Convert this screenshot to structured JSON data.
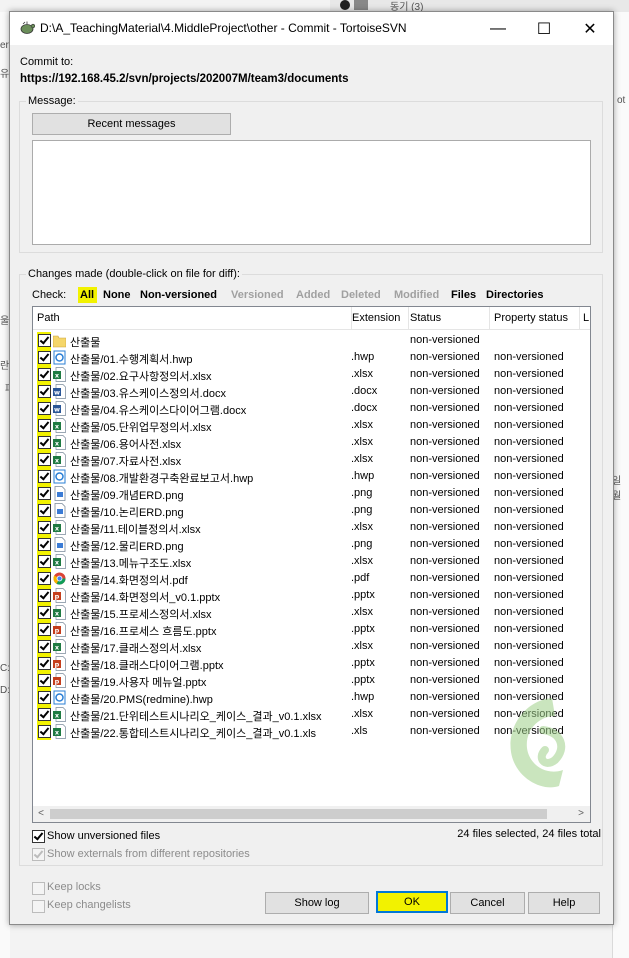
{
  "window": {
    "title": "D:\\A_TeachingMaterial\\4.MiddleProject\\other - Commit - TortoiseSVN",
    "minimize": "—",
    "maximize": "☐",
    "close": "✕"
  },
  "background": {
    "top_text": "동기 (3)",
    "left_frags": [
      "er",
      "유",
      "란",
      "파",
      "울",
      "C:",
      "D:"
    ],
    "right_frags": [
      "ot",
      "일월"
    ]
  },
  "commit": {
    "to_label": "Commit to:",
    "url": "https://192.168.45.2/svn/projects/202007M/team3/documents",
    "message_label": "Message:",
    "recent_messages": "Recent messages",
    "message_text": ""
  },
  "changes": {
    "label": "Changes made (double-click on file for diff):",
    "check_label": "Check:",
    "filters": [
      {
        "label": "All",
        "enabled": true
      },
      {
        "label": "None",
        "enabled": true
      },
      {
        "label": "Non-versioned",
        "enabled": true
      },
      {
        "label": "Versioned",
        "enabled": false
      },
      {
        "label": "Added",
        "enabled": false
      },
      {
        "label": "Deleted",
        "enabled": false
      },
      {
        "label": "Modified",
        "enabled": false
      },
      {
        "label": "Files",
        "enabled": true
      },
      {
        "label": "Directories",
        "enabled": true
      }
    ],
    "columns": [
      "Path",
      "Extension",
      "Status",
      "Property status",
      "L"
    ],
    "rows": [
      {
        "path": "산출물",
        "ext": "",
        "status": "non-versioned",
        "prop": "",
        "icon": "folder-icon",
        "color": "#f5d66a"
      },
      {
        "path": "산출물/01.수행계획서.hwp",
        "ext": ".hwp",
        "status": "non-versioned",
        "prop": "non-versioned",
        "icon": "hwp-file-icon",
        "color": "#2a7fd6"
      },
      {
        "path": "산출물/02.요구사항정의서.xlsx",
        "ext": ".xlsx",
        "status": "non-versioned",
        "prop": "non-versioned",
        "icon": "excel-file-icon",
        "color": "#1f7a42"
      },
      {
        "path": "산출물/03.유스케이스정의서.docx",
        "ext": ".docx",
        "status": "non-versioned",
        "prop": "non-versioned",
        "icon": "word-file-icon",
        "color": "#2b5797"
      },
      {
        "path": "산출물/04.유스케이스다이어그램.docx",
        "ext": ".docx",
        "status": "non-versioned",
        "prop": "non-versioned",
        "icon": "word-file-icon",
        "color": "#2b5797"
      },
      {
        "path": "산출물/05.단위업무정의서.xlsx",
        "ext": ".xlsx",
        "status": "non-versioned",
        "prop": "non-versioned",
        "icon": "excel-file-icon",
        "color": "#1f7a42"
      },
      {
        "path": "산출물/06.용어사전.xlsx",
        "ext": ".xlsx",
        "status": "non-versioned",
        "prop": "non-versioned",
        "icon": "excel-file-icon",
        "color": "#1f7a42"
      },
      {
        "path": "산출물/07.자료사전.xlsx",
        "ext": ".xlsx",
        "status": "non-versioned",
        "prop": "non-versioned",
        "icon": "excel-file-icon",
        "color": "#1f7a42"
      },
      {
        "path": "산출물/08.개발환경구축완료보고서.hwp",
        "ext": ".hwp",
        "status": "non-versioned",
        "prop": "non-versioned",
        "icon": "hwp-file-icon",
        "color": "#2a7fd6"
      },
      {
        "path": "산출물/09.개념ERD.png",
        "ext": ".png",
        "status": "non-versioned",
        "prop": "non-versioned",
        "icon": "image-file-icon",
        "color": "#3a7bd5"
      },
      {
        "path": "산출물/10.논리ERD.png",
        "ext": ".png",
        "status": "non-versioned",
        "prop": "non-versioned",
        "icon": "image-file-icon",
        "color": "#3a7bd5"
      },
      {
        "path": "산출물/11.테이블정의서.xlsx",
        "ext": ".xlsx",
        "status": "non-versioned",
        "prop": "non-versioned",
        "icon": "excel-file-icon",
        "color": "#1f7a42"
      },
      {
        "path": "산출물/12.물리ERD.png",
        "ext": ".png",
        "status": "non-versioned",
        "prop": "non-versioned",
        "icon": "image-file-icon",
        "color": "#3a7bd5"
      },
      {
        "path": "산출물/13.메뉴구조도.xlsx",
        "ext": ".xlsx",
        "status": "non-versioned",
        "prop": "non-versioned",
        "icon": "excel-file-icon",
        "color": "#1f7a42"
      },
      {
        "path": "산출물/14.화면정의서.pdf",
        "ext": ".pdf",
        "status": "non-versioned",
        "prop": "non-versioned",
        "icon": "chrome-pdf-icon",
        "color": "#db4437"
      },
      {
        "path": "산출물/14.화면정의서_v0.1.pptx",
        "ext": ".pptx",
        "status": "non-versioned",
        "prop": "non-versioned",
        "icon": "powerpoint-file-icon",
        "color": "#c43e1c"
      },
      {
        "path": "산출물/15.프로세스정의서.xlsx",
        "ext": ".xlsx",
        "status": "non-versioned",
        "prop": "non-versioned",
        "icon": "excel-file-icon",
        "color": "#1f7a42"
      },
      {
        "path": "산출물/16.프로세스 흐름도.pptx",
        "ext": ".pptx",
        "status": "non-versioned",
        "prop": "non-versioned",
        "icon": "powerpoint-file-icon",
        "color": "#c43e1c"
      },
      {
        "path": "산출물/17.클래스정의서.xlsx",
        "ext": ".xlsx",
        "status": "non-versioned",
        "prop": "non-versioned",
        "icon": "excel-file-icon",
        "color": "#1f7a42"
      },
      {
        "path": "산출물/18.클래스다이어그램.pptx",
        "ext": ".pptx",
        "status": "non-versioned",
        "prop": "non-versioned",
        "icon": "powerpoint-file-icon",
        "color": "#c43e1c"
      },
      {
        "path": "산출물/19.사용자 메뉴얼.pptx",
        "ext": ".pptx",
        "status": "non-versioned",
        "prop": "non-versioned",
        "icon": "powerpoint-file-icon",
        "color": "#c43e1c"
      },
      {
        "path": "산출물/20.PMS(redmine).hwp",
        "ext": ".hwp",
        "status": "non-versioned",
        "prop": "non-versioned",
        "icon": "hwp-file-icon",
        "color": "#2a7fd6"
      },
      {
        "path": "산출물/21.단위테스트시나리오_케이스_결과_v0.1.xlsx",
        "ext": ".xlsx",
        "status": "non-versioned",
        "prop": "non-versioned",
        "icon": "excel-file-icon",
        "color": "#1f7a42"
      },
      {
        "path": "산출물/22.통합테스트시나리오_케이스_결과_v0.1.xls",
        "ext": ".xls",
        "status": "non-versioned",
        "prop": "non-versioned",
        "icon": "excel-file-icon",
        "color": "#1f7a42"
      }
    ],
    "show_unversioned": "Show unversioned files",
    "show_externals": "Show externals from different repositories",
    "selection_summary": "24 files selected, 24 files total"
  },
  "options": {
    "keep_locks": "Keep locks",
    "keep_changelists": "Keep changelists"
  },
  "buttons": {
    "show_log": "Show log",
    "ok": "OK",
    "cancel": "Cancel",
    "help": "Help"
  },
  "colors": {
    "highlight": "#f2f200",
    "accent": "#0078d7"
  }
}
